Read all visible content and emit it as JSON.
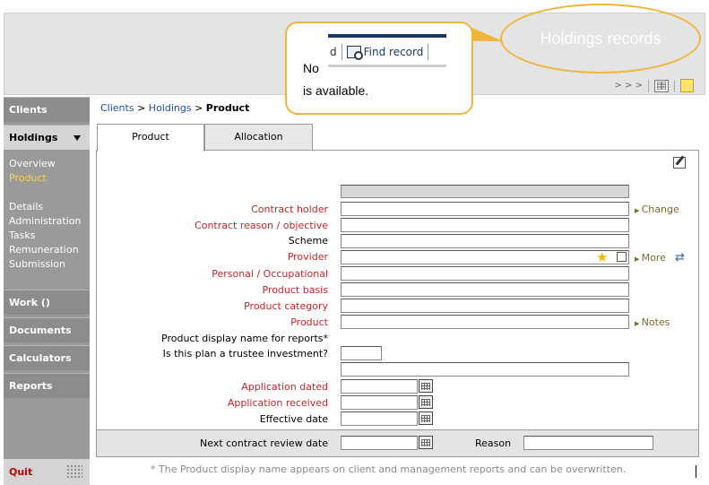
{
  "header": {
    "nav_arrows": ">  >  >",
    "icons": [
      "grid-icon",
      "sticky-note-icon"
    ]
  },
  "callout": {
    "line1": "No",
    "line2": "is available.",
    "snippet": {
      "partial_text": "d",
      "find_record_label": "Find record"
    }
  },
  "highlight": {
    "label": "Holdings records"
  },
  "sidebar": {
    "clients": "Clients",
    "holdings": "Holdings",
    "sub_items": [
      "Overview",
      "Product",
      "Details",
      "Administration",
      "Tasks",
      "Remuneration",
      "Submission"
    ],
    "current_sub": "Product",
    "work": "Work ()",
    "documents": "Documents",
    "calculators": "Calculators",
    "reports": "Reports",
    "quit": "Quit"
  },
  "breadcrumb": {
    "clients": "Clients",
    "sep": " > ",
    "holdings": "Holdings",
    "current": "Product"
  },
  "tabs": [
    {
      "label": "Product",
      "active": true
    },
    {
      "label": "Allocation",
      "active": false
    }
  ],
  "form": {
    "labels": {
      "contract_holder": "Contract holder",
      "contract_reason": "Contract reason / objective",
      "scheme": "Scheme",
      "provider": "Provider",
      "personal_occupational": "Personal / Occupational",
      "product_basis": "Product basis",
      "product_category": "Product category",
      "product": "Product",
      "display_name": "Product display name for reports*",
      "trustee": "Is this plan a trustee investment?",
      "application_dated": "Application dated",
      "application_received": "Application received",
      "effective_date": "Effective date",
      "next_review": "Next contract review date",
      "reason": "Reason"
    },
    "links": {
      "change": "Change",
      "more": "More",
      "notes": "Notes"
    }
  },
  "footnote": "* The Product display name appears on client and management reports and can be overwritten.",
  "colors": {
    "required_label": "#c0272d",
    "link": "#1f4fa8",
    "callout_border": "#f0b53c",
    "sidebar_bg": "#9a9a9a",
    "current_sub": "#ffd34a"
  }
}
